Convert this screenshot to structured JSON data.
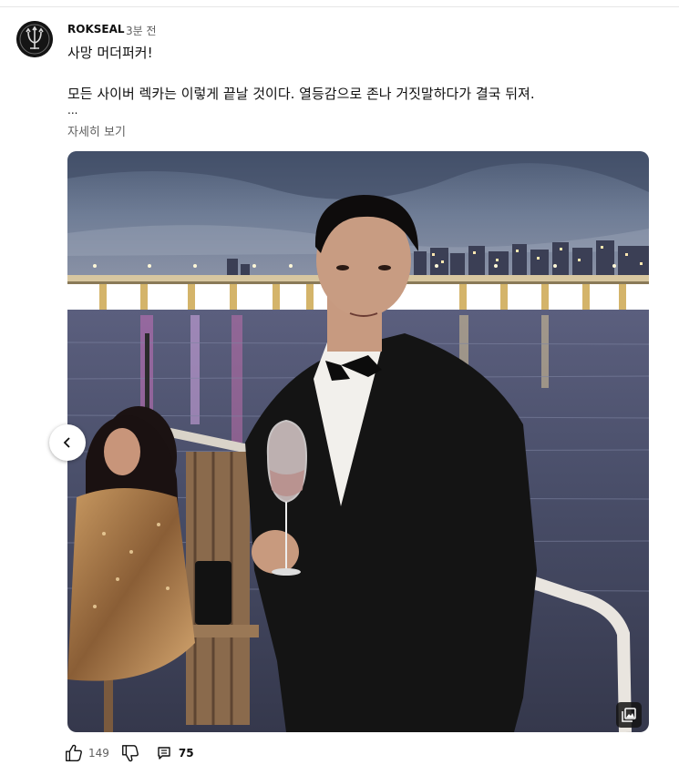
{
  "post": {
    "author": "ROKSEAL",
    "time": "3분 전",
    "line1": "사망 머더퍼커!",
    "line2": "모든 사이버 렉카는 이렇게 끝날 것이다. 열등감으로 존나 거짓말하다가 결국 뒤져.",
    "ellipsis": "...",
    "read_more": "자세히 보기"
  },
  "actions": {
    "likes": "149",
    "replies": "75"
  },
  "icons": {
    "avatar": "trident-emblem-icon",
    "prev": "chevron-left-icon",
    "gallery": "gallery-icon",
    "like": "thumbs-up-icon",
    "dislike": "thumbs-down-icon",
    "comment": "comment-icon"
  },
  "colors": {
    "text": "#0f0f0f",
    "muted": "#606060"
  }
}
